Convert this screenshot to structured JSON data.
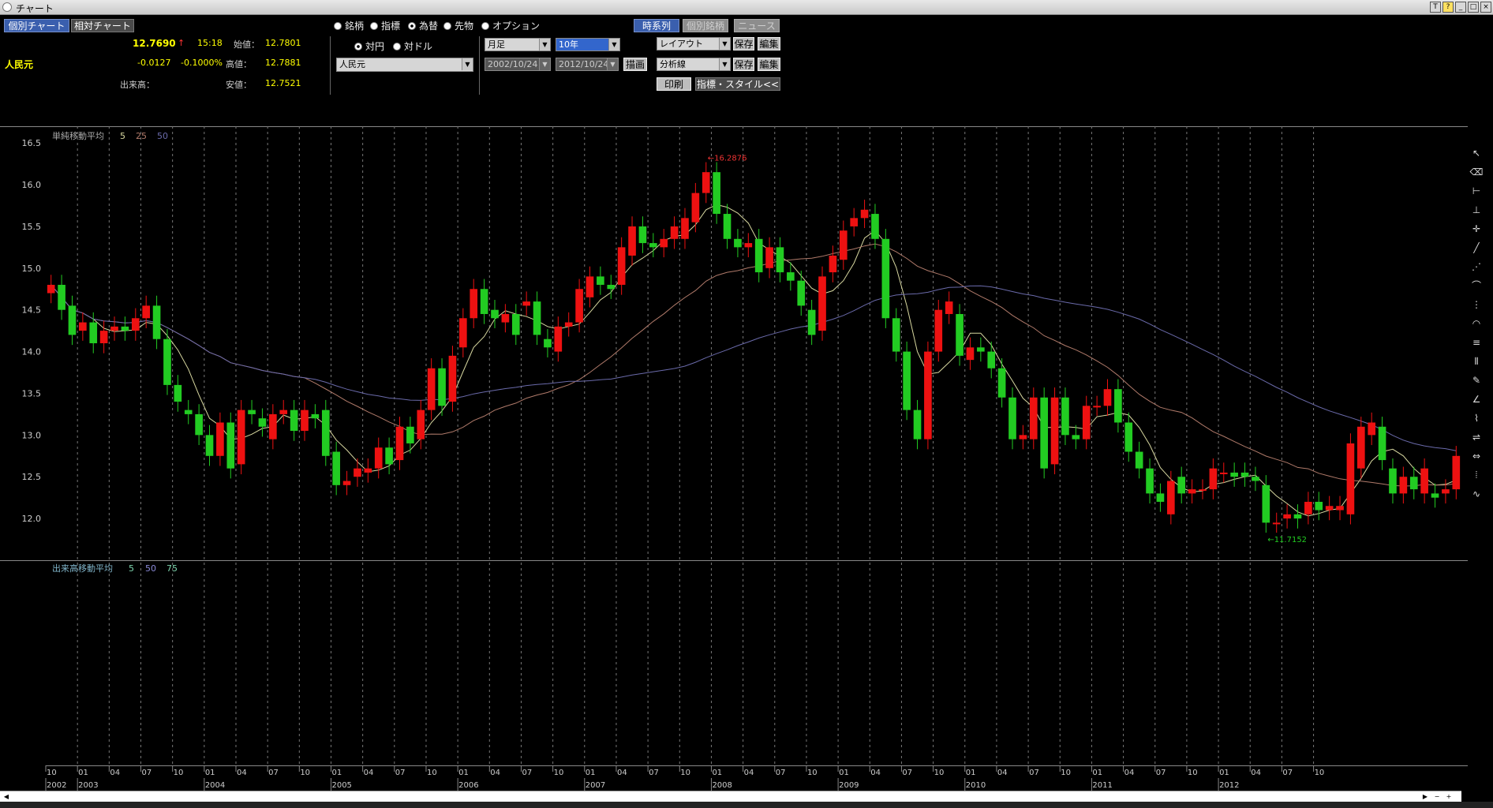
{
  "window": {
    "title": "チャート",
    "buttons": [
      "T",
      "?",
      "_",
      "□",
      "×"
    ]
  },
  "header": {
    "tabs": [
      {
        "label": "個別チャート",
        "active": true
      },
      {
        "label": "相対チャート",
        "active": false
      }
    ],
    "price": "12.7690",
    "arrow": "↑",
    "time": "15:18",
    "change": "-0.0127",
    "change_pct": "-0.1000%",
    "name": "人民元",
    "volume_label": "出来高：",
    "open_label": "始値：",
    "open_value": "12.7801",
    "high_label": "高値：",
    "high_value": "12.7881",
    "low_label": "安値：",
    "low_value": "12.7521"
  },
  "category_radios": [
    {
      "label": "銘柄",
      "selected": false
    },
    {
      "label": "指標",
      "selected": false
    },
    {
      "label": "為替",
      "selected": true
    },
    {
      "label": "先物",
      "selected": false
    },
    {
      "label": "オプション",
      "selected": false
    }
  ],
  "pair_radios": [
    {
      "label": "対円",
      "selected": true
    },
    {
      "label": "対ドル",
      "selected": false
    }
  ],
  "currency_select": "人民元",
  "period_select": "月足",
  "range_select": "10年",
  "date_from": "2002/10/24",
  "date_to": "2012/10/24",
  "draw_button": "描画",
  "view_buttons": [
    "時系列",
    "個別銘柄",
    "ニュース"
  ],
  "layout_select": "レイアウト",
  "analysis_select": "分析線",
  "save_label": "保存",
  "edit_label": "編集",
  "print_label": "印刷",
  "style_label": "指標・スタイル<<",
  "colors": {
    "up": "#ee1111",
    "down": "#22cc22",
    "ma5": "#d8d8a0",
    "ma25": "#b07a6a",
    "ma50": "#6a6aaa",
    "text_yellow": "#ffff00",
    "accent_blue": "#3a5fae"
  },
  "chart_data": {
    "type": "candlestick",
    "x_tick_labels": [
      "10",
      "01",
      "04",
      "07",
      "10",
      "01",
      "04",
      "07",
      "10",
      "01",
      "04",
      "07",
      "10",
      "01",
      "04",
      "07",
      "10",
      "01",
      "04",
      "07",
      "10",
      "01",
      "04",
      "07",
      "10",
      "01",
      "04",
      "07",
      "10",
      "01",
      "04",
      "07",
      "10",
      "01",
      "04",
      "07",
      "10",
      "01",
      "04",
      "07",
      "10"
    ],
    "years": [
      "2002",
      "2003",
      "2004",
      "2005",
      "2006",
      "2007",
      "2008",
      "2009",
      "2010",
      "2011",
      "2012"
    ],
    "ylim": [
      11.5,
      16.7
    ],
    "y_ticks": [
      "16.5",
      "16.0",
      "15.5",
      "15.0",
      "14.5",
      "14.0",
      "13.5",
      "13.0",
      "12.5",
      "12.0"
    ],
    "price_legend": {
      "title": "単純移動平均",
      "periods": [
        "5",
        "25",
        "50"
      ]
    },
    "volume_legend": {
      "title": "出来高移動平均",
      "periods": [
        "5",
        "50",
        "75"
      ]
    },
    "annotations": [
      {
        "text": "←16.2876"
      },
      {
        "text": "←11.7152"
      }
    ],
    "series": [
      {
        "name": "人民元",
        "open_close": [
          [
            14.7,
            14.8
          ],
          [
            14.8,
            14.5
          ],
          [
            14.55,
            14.2
          ],
          [
            14.25,
            14.35
          ],
          [
            14.35,
            14.1
          ],
          [
            14.1,
            14.25
          ],
          [
            14.25,
            14.3
          ],
          [
            14.3,
            14.25
          ],
          [
            14.25,
            14.4
          ],
          [
            14.4,
            14.55
          ],
          [
            14.55,
            14.15
          ],
          [
            14.15,
            13.6
          ],
          [
            13.6,
            13.4
          ],
          [
            13.3,
            13.25
          ],
          [
            13.25,
            13.0
          ],
          [
            13.0,
            12.75
          ],
          [
            12.75,
            13.15
          ],
          [
            13.15,
            12.6
          ],
          [
            12.65,
            13.3
          ],
          [
            13.3,
            13.25
          ],
          [
            13.2,
            13.1
          ],
          [
            12.95,
            13.25
          ],
          [
            13.25,
            13.3
          ],
          [
            13.3,
            13.05
          ],
          [
            13.05,
            13.3
          ],
          [
            13.25,
            13.2
          ],
          [
            13.3,
            12.75
          ],
          [
            12.8,
            12.4
          ],
          [
            12.4,
            12.45
          ],
          [
            12.5,
            12.6
          ],
          [
            12.55,
            12.6
          ],
          [
            12.6,
            12.85
          ],
          [
            12.85,
            12.65
          ],
          [
            12.7,
            13.1
          ],
          [
            13.1,
            12.9
          ],
          [
            12.95,
            13.3
          ],
          [
            13.3,
            13.8
          ],
          [
            13.8,
            13.35
          ],
          [
            13.4,
            13.95
          ],
          [
            14.05,
            14.4
          ],
          [
            14.4,
            14.75
          ],
          [
            14.75,
            14.45
          ],
          [
            14.5,
            14.4
          ],
          [
            14.35,
            14.45
          ],
          [
            14.45,
            14.2
          ],
          [
            14.55,
            14.6
          ],
          [
            14.6,
            14.2
          ],
          [
            14.15,
            14.05
          ],
          [
            14.0,
            14.3
          ],
          [
            14.3,
            14.35
          ],
          [
            14.35,
            14.75
          ],
          [
            14.65,
            14.9
          ],
          [
            14.9,
            14.8
          ],
          [
            14.8,
            14.75
          ],
          [
            14.8,
            15.25
          ],
          [
            15.15,
            15.5
          ],
          [
            15.5,
            15.3
          ],
          [
            15.3,
            15.25
          ],
          [
            15.25,
            15.35
          ],
          [
            15.35,
            15.5
          ],
          [
            15.35,
            15.6
          ],
          [
            15.55,
            15.9
          ],
          [
            15.9,
            16.15
          ],
          [
            16.15,
            15.65
          ],
          [
            15.65,
            15.35
          ],
          [
            15.35,
            15.25
          ],
          [
            15.25,
            15.3
          ],
          [
            15.35,
            14.95
          ],
          [
            15.0,
            15.25
          ],
          [
            15.25,
            14.95
          ],
          [
            14.95,
            14.85
          ],
          [
            14.85,
            14.55
          ],
          [
            14.5,
            14.2
          ],
          [
            14.25,
            14.9
          ],
          [
            14.95,
            15.15
          ],
          [
            15.1,
            15.45
          ],
          [
            15.5,
            15.6
          ],
          [
            15.6,
            15.7
          ],
          [
            15.65,
            15.35
          ],
          [
            15.35,
            14.4
          ],
          [
            14.4,
            14.0
          ],
          [
            14.0,
            13.3
          ],
          [
            13.3,
            12.95
          ],
          [
            12.95,
            14.0
          ],
          [
            14.0,
            14.5
          ],
          [
            14.45,
            14.6
          ],
          [
            14.45,
            13.95
          ],
          [
            13.9,
            14.05
          ],
          [
            14.05,
            14.0
          ],
          [
            14.0,
            13.8
          ],
          [
            13.8,
            13.45
          ],
          [
            13.45,
            12.95
          ],
          [
            12.95,
            13.0
          ],
          [
            12.95,
            13.45
          ],
          [
            13.45,
            12.6
          ],
          [
            12.65,
            13.45
          ],
          [
            13.45,
            13.0
          ],
          [
            13.0,
            12.95
          ],
          [
            12.95,
            13.35
          ],
          [
            13.35,
            13.35
          ],
          [
            13.35,
            13.55
          ],
          [
            13.55,
            13.15
          ],
          [
            13.15,
            12.8
          ],
          [
            12.8,
            12.6
          ],
          [
            12.6,
            12.3
          ],
          [
            12.3,
            12.2
          ],
          [
            12.05,
            12.45
          ],
          [
            12.5,
            12.3
          ],
          [
            12.3,
            12.35
          ],
          [
            12.35,
            12.35
          ],
          [
            12.35,
            12.6
          ],
          [
            12.55,
            12.55
          ],
          [
            12.55,
            12.5
          ],
          [
            12.55,
            12.5
          ],
          [
            12.5,
            12.45
          ],
          [
            12.4,
            11.95
          ],
          [
            11.95,
            11.95
          ],
          [
            12.0,
            12.05
          ],
          [
            12.05,
            12.0
          ],
          [
            12.05,
            12.2
          ],
          [
            12.2,
            12.1
          ],
          [
            12.1,
            12.15
          ],
          [
            12.1,
            12.15
          ],
          [
            12.05,
            12.9
          ],
          [
            12.6,
            13.1
          ],
          [
            13.0,
            13.15
          ],
          [
            13.1,
            12.7
          ],
          [
            12.6,
            12.3
          ],
          [
            12.3,
            12.5
          ],
          [
            12.5,
            12.35
          ],
          [
            12.3,
            12.6
          ],
          [
            12.3,
            12.25
          ],
          [
            12.3,
            12.35
          ],
          [
            12.35,
            12.75
          ]
        ]
      }
    ]
  }
}
